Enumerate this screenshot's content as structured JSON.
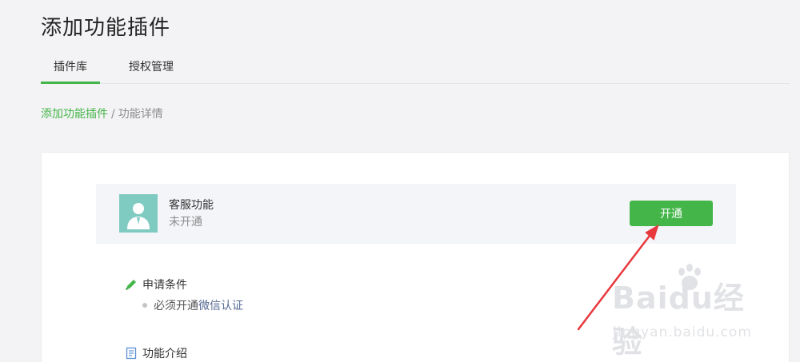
{
  "header": {
    "title": "添加功能插件"
  },
  "tabs": [
    {
      "label": "插件库",
      "active": true
    },
    {
      "label": "授权管理",
      "active": false
    }
  ],
  "breadcrumb": {
    "parent": "添加功能插件",
    "separator": "/",
    "current": "功能详情"
  },
  "plugin": {
    "name": "客服功能",
    "status": "未开通",
    "action_label": "开通"
  },
  "sections": {
    "conditions": {
      "title": "申请条件",
      "item_prefix": "必须开通",
      "item_link": "微信认证"
    },
    "intro": {
      "title": "功能介绍"
    }
  },
  "watermark": {
    "brand_text": "Baidu经验",
    "url": "jingyan.baidu.com"
  },
  "colors": {
    "accent_green": "#44b549",
    "link_blue": "#576b95",
    "annotation_arrow": "#e8383d"
  }
}
